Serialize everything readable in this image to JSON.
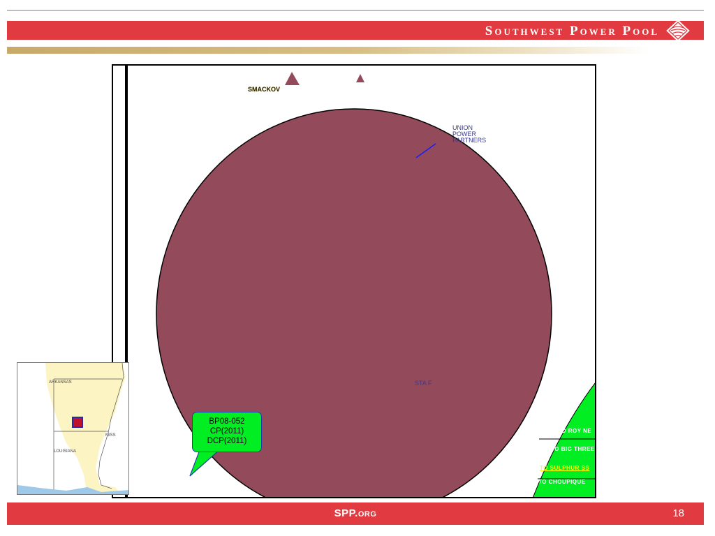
{
  "header": {
    "title": "Southwest Power Pool",
    "logo_icon": "spp-diamond-logo-icon"
  },
  "map": {
    "labels": {
      "smackover": "SMACKOV",
      "union_power_partners": "UNION\nPOWER\nPARTNERS",
      "sta_f": "STA F"
    },
    "green_labels": {
      "roy": "TO ROY NE",
      "big_three": "TO BIG THREE",
      "sulphur": "TO SULPHUR SS",
      "choupique": "TO CHOUPIQUE"
    },
    "callout": {
      "line1": "BP08-052",
      "line2": "CP(2011)",
      "line3": "DCP(2011)"
    },
    "colors": {
      "circle": "#934a5b",
      "green": "#00ee22",
      "callout_border": "#1a3fa8"
    }
  },
  "inset": {
    "labels": {
      "arkansas": "ARKANSAS",
      "mississippi": "MISS",
      "louisiana": "LOUISIANA"
    }
  },
  "footer": {
    "site": "SPP.org",
    "page_number": "18"
  }
}
